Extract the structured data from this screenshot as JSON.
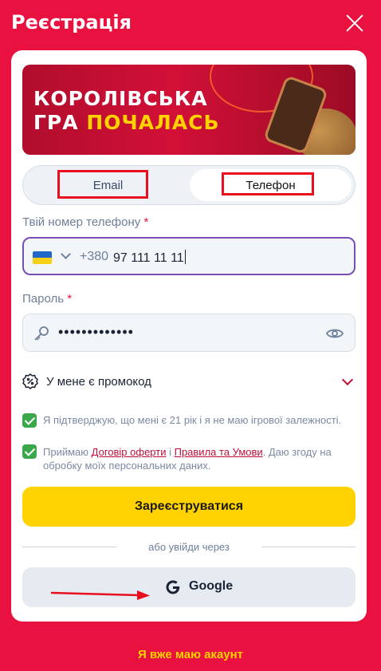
{
  "header": {
    "title": "Реєстрація"
  },
  "banner": {
    "line1": "КОРОЛІВСЬКА",
    "line2_part1": "ГРА ",
    "line2_part2": "ПОЧАЛАСЬ"
  },
  "tabs": {
    "email": "Email",
    "phone": "Телефон",
    "active": "phone"
  },
  "phone": {
    "label": "Твій номер телефону",
    "required_mark": "*",
    "country_flag": "ukraine-flag",
    "dial_code": "+380",
    "value": "97 111 11 11"
  },
  "password": {
    "label": "Пароль",
    "required_mark": "*",
    "value": "•••••••••••••"
  },
  "promo": {
    "label": "У мене є промокод"
  },
  "consents": {
    "age": {
      "checked": true,
      "text": "Я підтверджую, що мені є 21 рік і я не маю ігрової залежності."
    },
    "terms": {
      "checked": true,
      "prefix": "Приймаю ",
      "offer_link": "Договір оферти",
      "middle": " і ",
      "rules_link": "Правила та Умови",
      "suffix": ". Даю згоду на обробку моїх персональних даних."
    }
  },
  "submit_label": "Зареєструватися",
  "divider_text": "або увійди через",
  "google_label": "Google",
  "login_link": "Я вже маю акаунт",
  "colors": {
    "brand_red": "#e8113f",
    "accent_yellow": "#ffd200",
    "check_green": "#3aa84a",
    "focus_purple": "#7a4fb5"
  }
}
